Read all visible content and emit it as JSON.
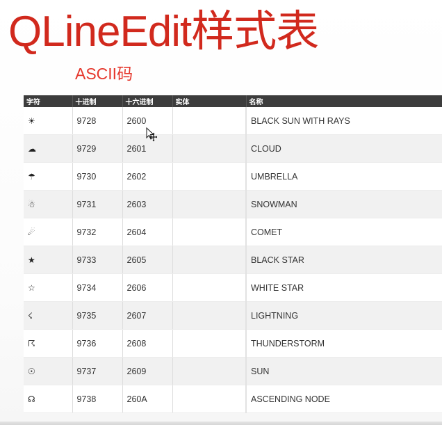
{
  "slide": {
    "title": "QLineEdit样式表",
    "subtitle": "ASCII码"
  },
  "table": {
    "headers": [
      "字符",
      "十进制",
      "十六进制",
      "实体",
      "名称"
    ],
    "rows": [
      {
        "char": "☀",
        "dec": "9728",
        "hex": "2600",
        "entity": "",
        "name": "BLACK SUN WITH RAYS"
      },
      {
        "char": "☁",
        "dec": "9729",
        "hex": "2601",
        "entity": "",
        "name": "CLOUD"
      },
      {
        "char": "☂",
        "dec": "9730",
        "hex": "2602",
        "entity": "",
        "name": "UMBRELLA"
      },
      {
        "char": "☃",
        "dec": "9731",
        "hex": "2603",
        "entity": "",
        "name": "SNOWMAN"
      },
      {
        "char": "☄",
        "dec": "9732",
        "hex": "2604",
        "entity": "",
        "name": "COMET"
      },
      {
        "char": "★",
        "dec": "9733",
        "hex": "2605",
        "entity": "",
        "name": "BLACK STAR"
      },
      {
        "char": "☆",
        "dec": "9734",
        "hex": "2606",
        "entity": "",
        "name": "WHITE STAR"
      },
      {
        "char": "☇",
        "dec": "9735",
        "hex": "2607",
        "entity": "",
        "name": "LIGHTNING"
      },
      {
        "char": "☈",
        "dec": "9736",
        "hex": "2608",
        "entity": "",
        "name": "THUNDERSTORM"
      },
      {
        "char": "☉",
        "dec": "9737",
        "hex": "2609",
        "entity": "",
        "name": "SUN"
      },
      {
        "char": "☊",
        "dec": "9738",
        "hex": "260A",
        "entity": "",
        "name": "ASCENDING NODE"
      }
    ]
  },
  "theme": {
    "title_color": "#d1291d",
    "subtitle_color": "#e5372c",
    "header_bg": "#3c3c3c",
    "row_alt_bg": "#f1f1f1"
  },
  "cursor_icon": "move-cursor-icon"
}
